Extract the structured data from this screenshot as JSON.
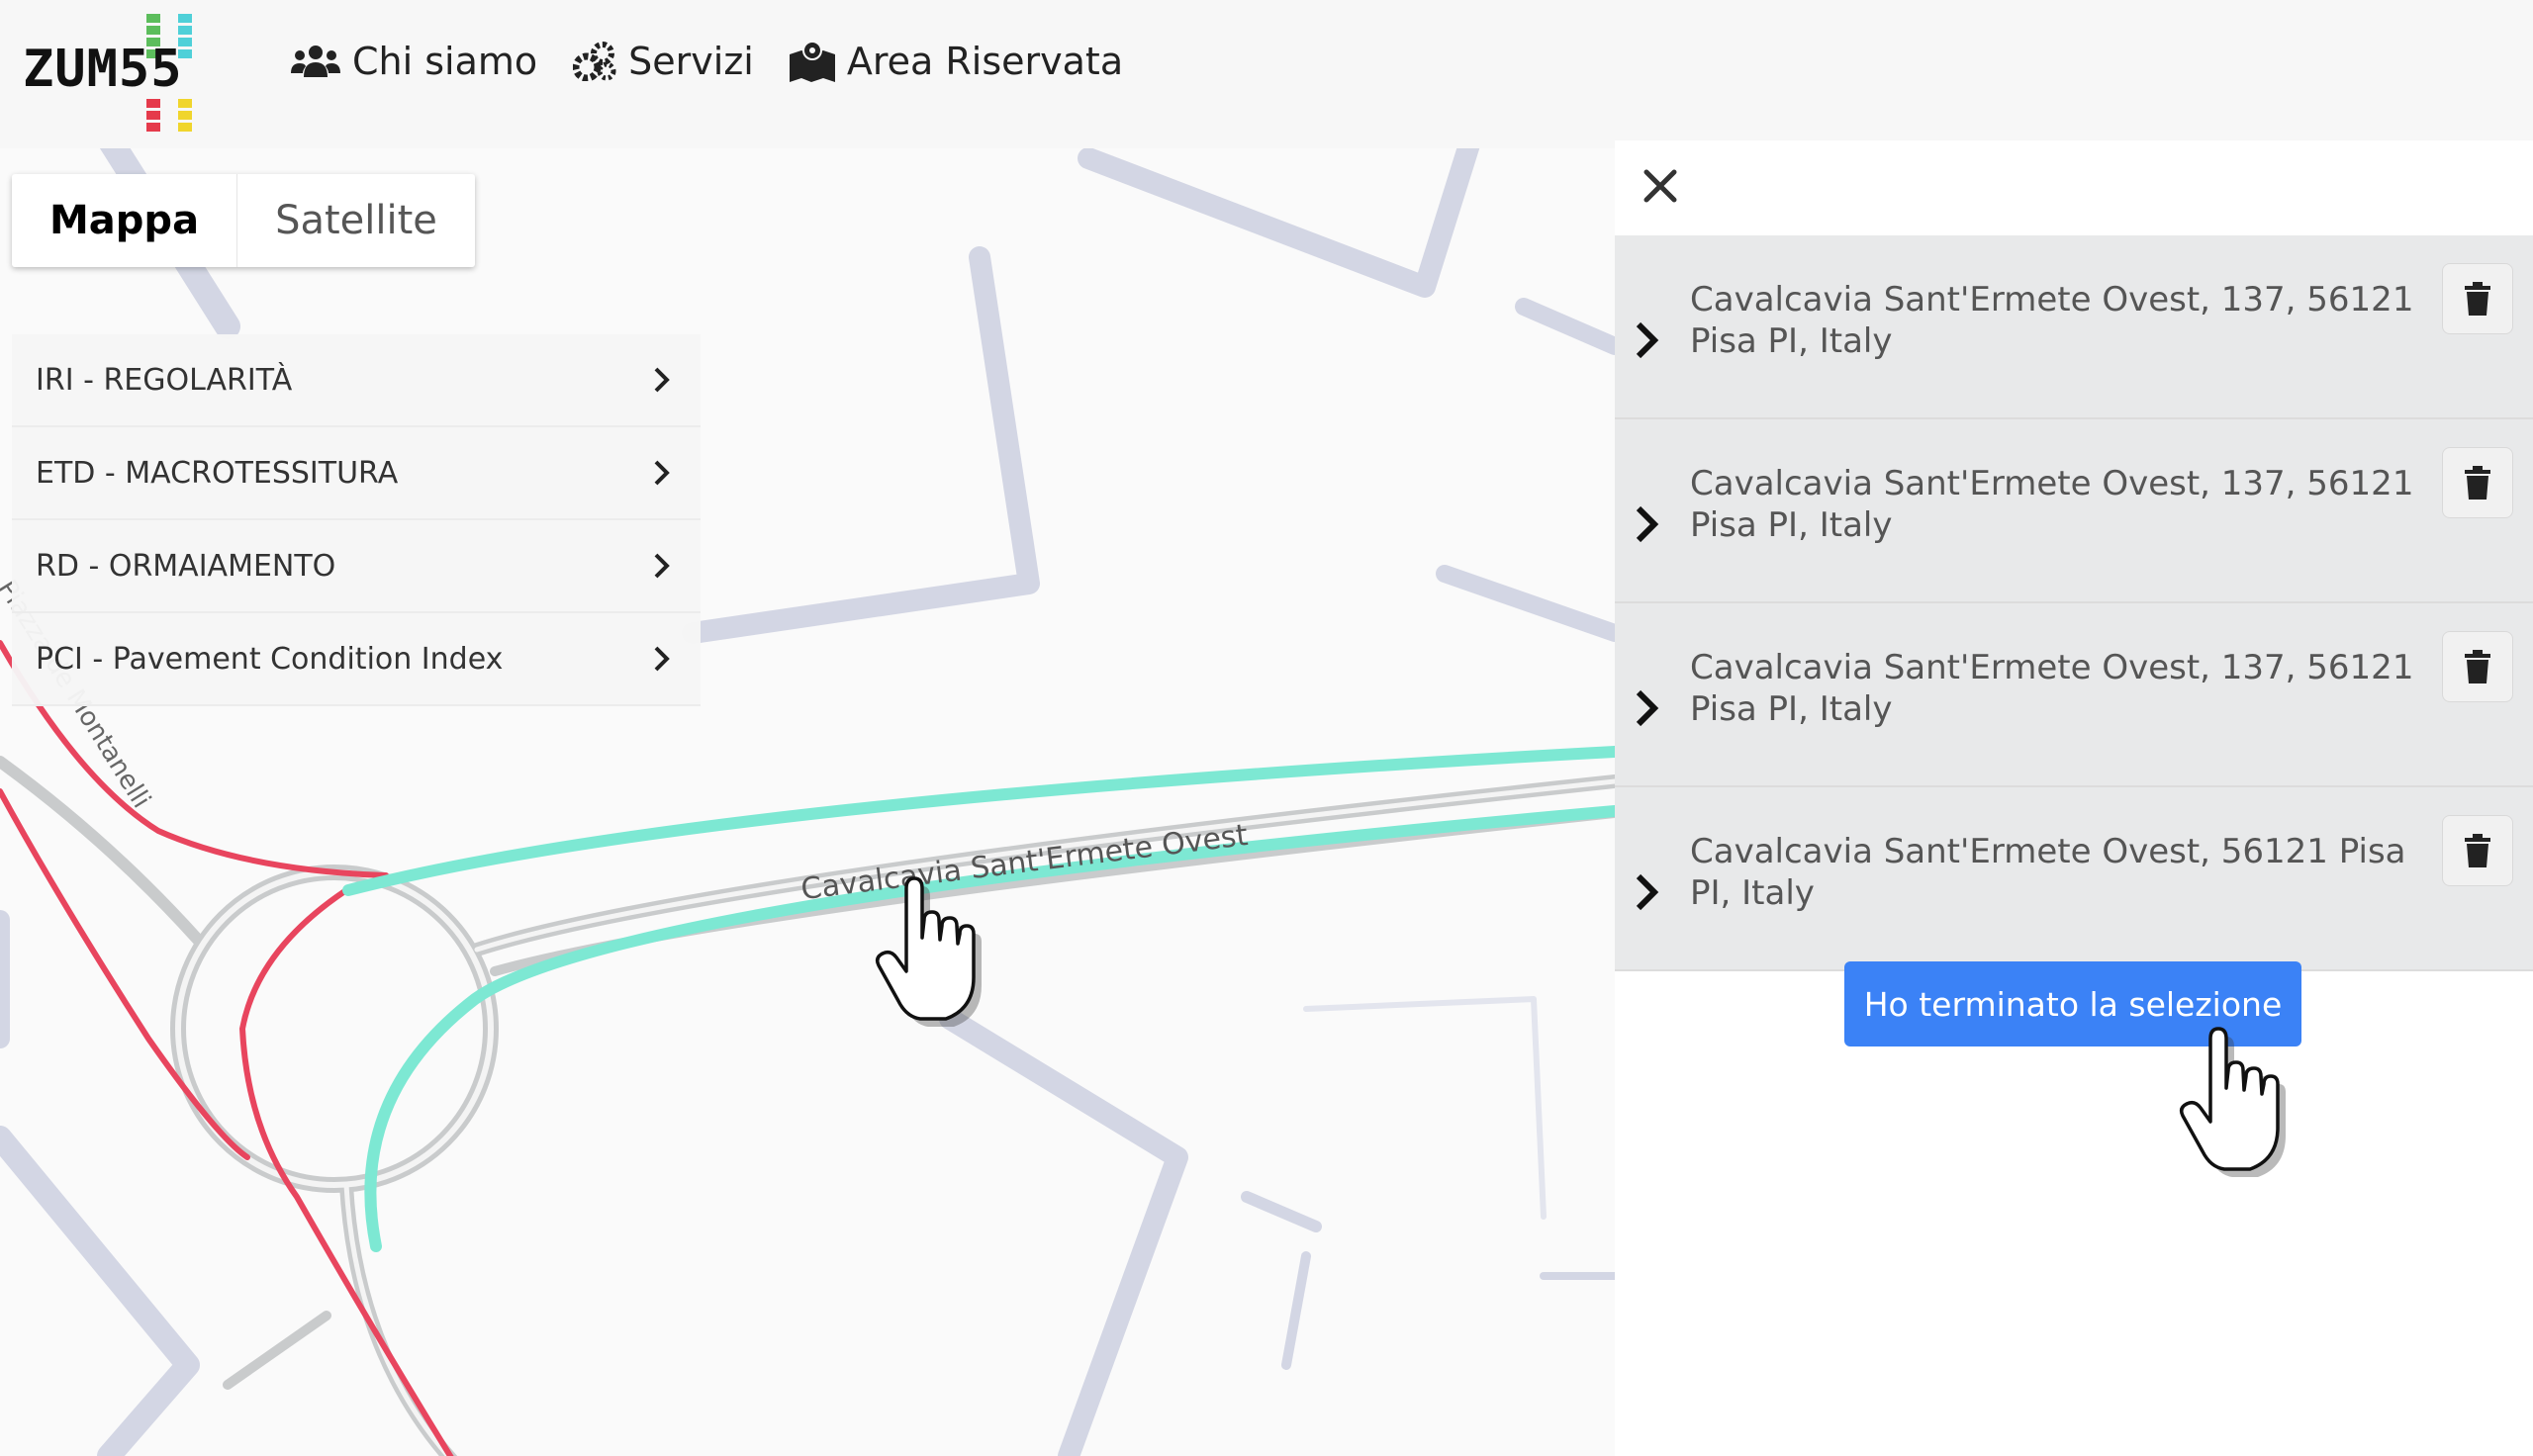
{
  "header": {
    "logo_text": "ZUM55",
    "nav": [
      {
        "label": "Chi siamo",
        "icon": "users-icon"
      },
      {
        "label": "Servizi",
        "icon": "cogs-icon"
      },
      {
        "label": "Area Riservata",
        "icon": "map-marker-icon"
      }
    ]
  },
  "map": {
    "type_buttons": {
      "map": "Mappa",
      "satellite": "Satellite"
    },
    "layers": [
      {
        "label": "IRI - REGOLARITÀ"
      },
      {
        "label": "ETD - MACROTESSITURA"
      },
      {
        "label": "RD - ORMAIAMENTO"
      },
      {
        "label": "PCI - Pavement Condition Index"
      }
    ],
    "street_labels": {
      "main": "Cavalcavia Sant'Ermete Ovest",
      "side": "Piazza de Montanelli"
    },
    "colors": {
      "selected_road": "#7de8d3",
      "red_road": "#e8455e",
      "building_shadow": "#d3d6e4"
    }
  },
  "panel": {
    "results": [
      {
        "address": "Cavalcavia Sant'Ermete Ovest, 137, 56121 Pisa PI, Italy"
      },
      {
        "address": "Cavalcavia Sant'Ermete Ovest, 137, 56121 Pisa PI, Italy"
      },
      {
        "address": "Cavalcavia Sant'Ermete Ovest, 137, 56121 Pisa PI, Italy"
      },
      {
        "address": "Cavalcavia Sant'Ermete Ovest, 56121 Pisa PI, Italy"
      }
    ],
    "done_label": "Ho terminato la selezione",
    "accent": "#3b82f6"
  }
}
